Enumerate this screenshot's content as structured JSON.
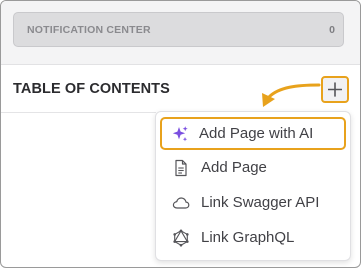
{
  "notification_center": {
    "label": "NOTIFICATION CENTER",
    "count": "0"
  },
  "toc": {
    "title": "TABLE OF CONTENTS",
    "add_button_icon": "plus-icon"
  },
  "menu": {
    "items": [
      {
        "label": "Add Page with AI",
        "icon": "sparkles-icon",
        "highlighted": true
      },
      {
        "label": "Add Page",
        "icon": "page-icon"
      },
      {
        "label": "Link Swagger API",
        "icon": "cloud-icon"
      },
      {
        "label": "Link GraphQL",
        "icon": "graphql-icon"
      }
    ]
  },
  "colors": {
    "highlight": "#e8a21c",
    "sparkles_accent": "#7a4fe0",
    "notification_bg": "#dcdcde",
    "text": "#414146"
  }
}
